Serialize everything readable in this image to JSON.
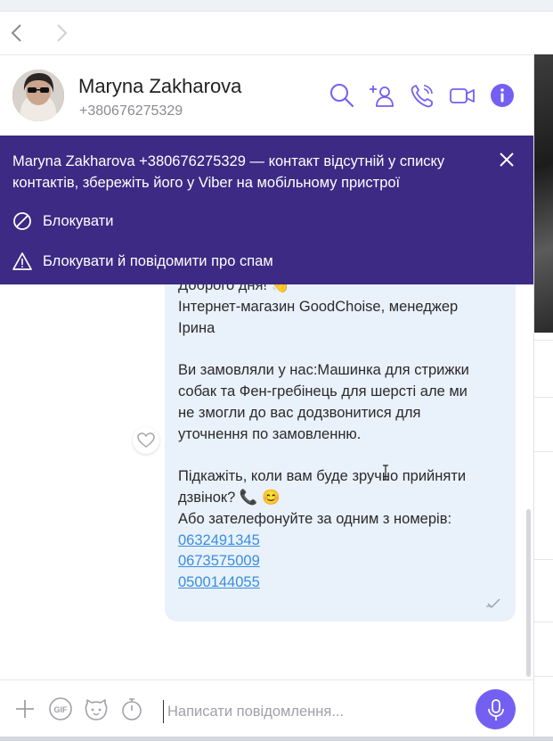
{
  "contact": {
    "name": "Maryna Zakharova",
    "phone": "+380676275329"
  },
  "banner": {
    "message": "Maryna Zakharova +380676275329 — контакт відсутній у списку контактів, збережіть його у Viber на мобільному пристрої",
    "block_label": "Блокувати",
    "block_report_label": "Блокувати й повідомити про спам"
  },
  "message": {
    "lines": [
      "Доброго дня! 👋",
      "Інтернет-магазин  GoodChoise, менеджер",
      "Ірина",
      "",
      "Ви замовляли у нас:Машинка для стрижки",
      "собак та Фен-гребінець для шерсті   але ми",
      "не змогли до вас додзвонитися для",
      "уточнення по замовленню.",
      "",
      "Підкажіть, коли вам буде зручно прийняти",
      "дзвінок? 📞 😊",
      "Або зателефонуйте за одним з номерів:"
    ],
    "phones": [
      "0632491345",
      "0673575009",
      "0500144055"
    ]
  },
  "composer": {
    "placeholder": "Написати повідомлення..."
  },
  "colors": {
    "accent": "#7360f2",
    "banner_bg": "#3c2a84",
    "bubble_bg": "#e9f1fb",
    "link": "#3a8ee0"
  },
  "icons": {
    "header": [
      "search-icon",
      "add-participant-icon",
      "call-icon",
      "video-call-icon",
      "info-icon"
    ],
    "composer": [
      "plus-icon",
      "gif-icon",
      "sticker-icon",
      "timer-icon",
      "microphone-icon"
    ]
  }
}
